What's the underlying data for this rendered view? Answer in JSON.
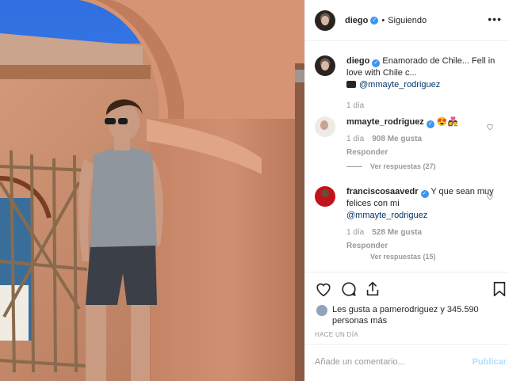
{
  "post": {
    "author": "diego",
    "verified_mark": "✓",
    "separator": "•",
    "follow_status": "Siguiendo",
    "more_icon": "more-horizontal-icon"
  },
  "caption": {
    "username": "diego",
    "text": "Enamorado de Chile... Fell in love with Chile c...",
    "tagged_icon": "camera-icon",
    "tagged": "@mmayte_rodriguez",
    "time": "1 día"
  },
  "comments": [
    {
      "username": "mmayte_rodriguez",
      "text": "😍👩‍❤️‍👨",
      "time": "1 día",
      "likes": "908 Me gusta",
      "reply": "Responder",
      "view_replies": "Ver respuestas (27)"
    },
    {
      "username": "franciscosaavedr",
      "text": "Y que sean muy felices con mi",
      "mention": "@mmayte_rodriguez",
      "time": "1 día",
      "likes": "528 Me gusta",
      "reply": "Responder",
      "view_replies": "Ver respuestas (15)"
    }
  ],
  "actions": {
    "icons": [
      "heart-icon",
      "comment-icon",
      "share-icon",
      "bookmark-icon"
    ],
    "likes_text": "Les gusta a pamerodriguez y 345.590 personas más",
    "time_ago": "HACE UN DÍA",
    "comment_placeholder": "Añade un comentario...",
    "publish_label": "Publicar"
  },
  "colors": {
    "link_blue": "#003569",
    "verified_blue": "#3897f0",
    "publish_disabled": "#b2dffc",
    "muted_text": "#999999"
  }
}
